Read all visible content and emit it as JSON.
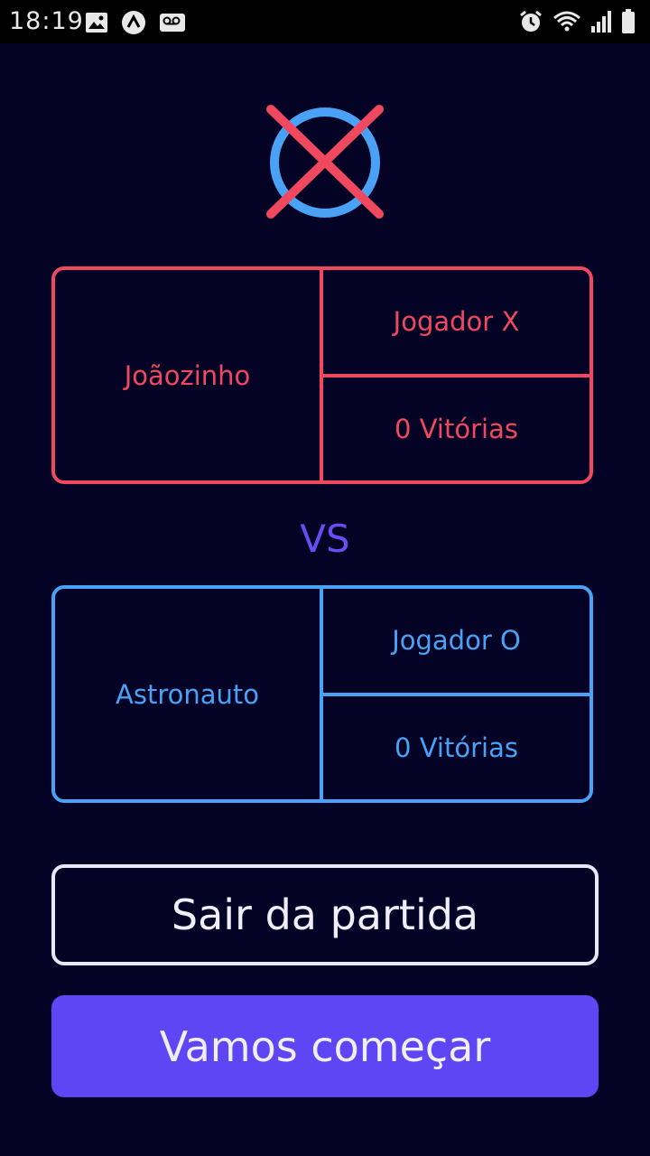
{
  "status_bar": {
    "time": "18:19",
    "icons_left": [
      "image-icon",
      "app-notification-icon",
      "voicemail-icon"
    ],
    "icons_right": [
      "alarm-icon",
      "wifi-icon",
      "signal-icon",
      "battery-icon"
    ]
  },
  "logo": {
    "circle_color": "#4aa2f7",
    "cross_color": "#f0485f"
  },
  "player_x": {
    "name": "Joãozinho",
    "role": "Jogador X",
    "wins": "0 Vitórias",
    "color": "#f0485f"
  },
  "versus": "VS",
  "player_o": {
    "name": "Astronauto",
    "role": "Jogador O",
    "wins": "0 Vitórias",
    "color": "#4aa2f7"
  },
  "buttons": {
    "exit_label": "Sair da partida",
    "start_label": "Vamos começar"
  },
  "colors": {
    "background": "#050325",
    "accent": "#5e46f5"
  }
}
